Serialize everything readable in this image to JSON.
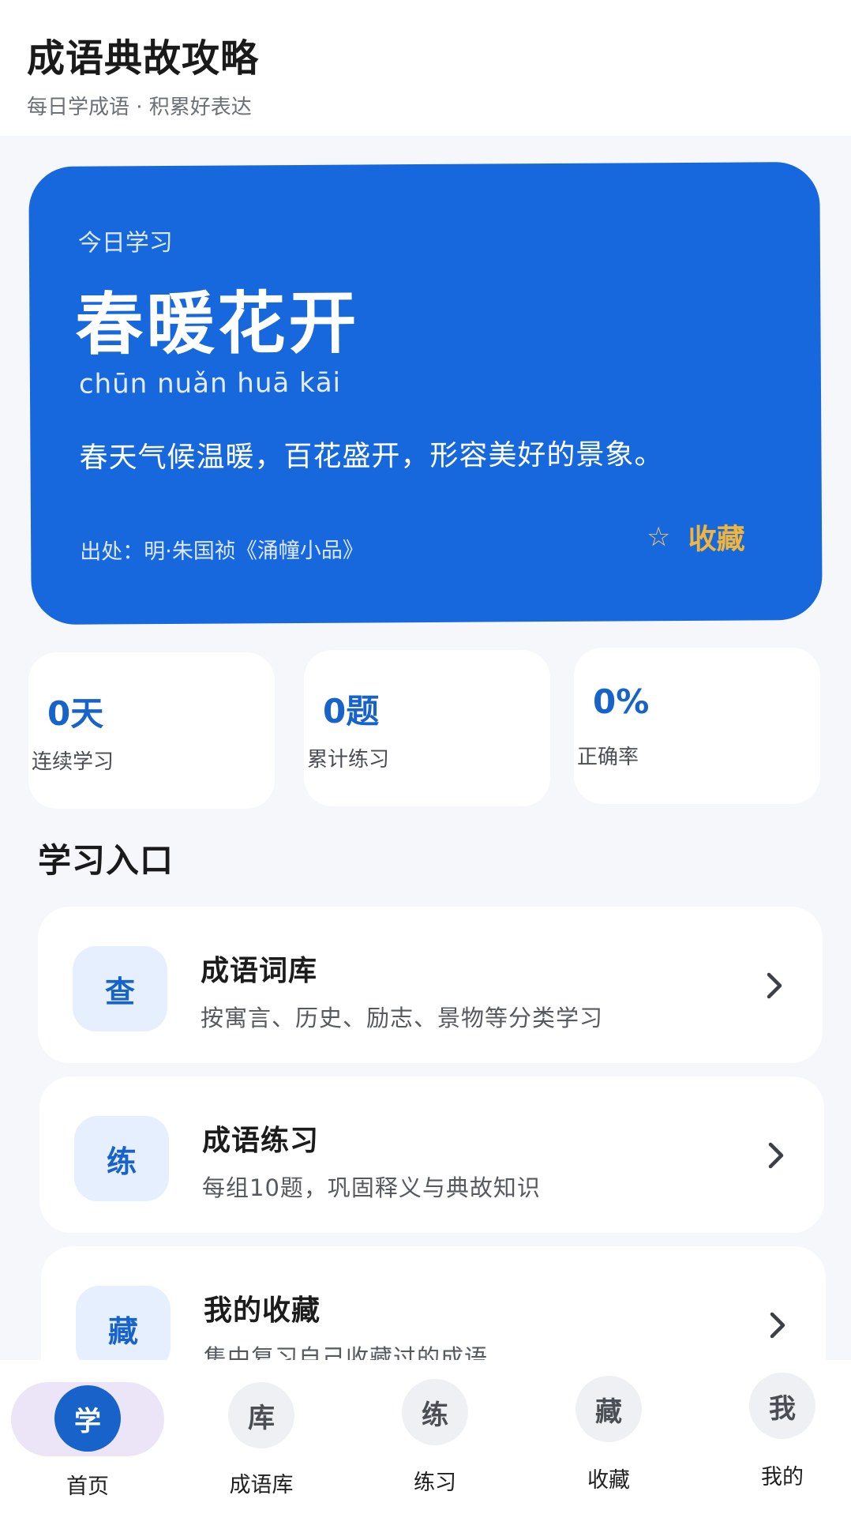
{
  "header": {
    "title": "成语典故攻略",
    "subtitle": "每日学成语 · 积累好表达"
  },
  "today": {
    "label": "今日学习",
    "idiom": "春暖花开",
    "pinyin": "chūn nuǎn huā kāi",
    "meaning": "春天气候温暖，百花盛开，形容美好的景象。",
    "source": "出处：明·朱国祯《涌幢小品》",
    "favorite": {
      "icon": "star-outline-icon",
      "label": "收藏"
    }
  },
  "stats": [
    {
      "value": "0天",
      "label": "连续学习"
    },
    {
      "value": "0题",
      "label": "累计练习"
    },
    {
      "value": "0%",
      "label": "正确率"
    }
  ],
  "section": {
    "title": "学习入口"
  },
  "entries": [
    {
      "icon_text": "查",
      "title": "成语词库",
      "desc": "按寓言、历史、励志、景物等分类学习"
    },
    {
      "icon_text": "练",
      "title": "成语练习",
      "desc": "每组10题，巩固释义与典故知识"
    },
    {
      "icon_text": "藏",
      "title": "我的收藏",
      "desc": "集中复习自己收藏过的成语"
    }
  ],
  "nav": [
    {
      "icon_text": "学",
      "label": "首页",
      "active": true
    },
    {
      "icon_text": "库",
      "label": "成语库",
      "active": false
    },
    {
      "icon_text": "练",
      "label": "练习",
      "active": false
    },
    {
      "icon_text": "藏",
      "label": "收藏",
      "active": false
    },
    {
      "icon_text": "我",
      "label": "我的",
      "active": false
    }
  ],
  "colors": {
    "primary": "#1768dc",
    "accent_gold": "#f2b53b",
    "page_bg": "#f5f7fb",
    "icon_tile_bg": "#e6effd",
    "nav_active_pill": "#ece4f7"
  }
}
